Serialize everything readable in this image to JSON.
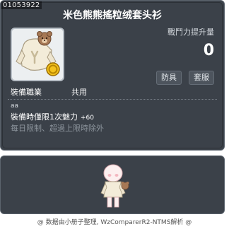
{
  "item": {
    "code": "01053922",
    "name": "米色熊熊搖粒绒套头衫",
    "ability_label": "戰鬥力提升量",
    "power_value": "0",
    "tags": [
      "防具",
      "套服"
    ],
    "job_label": "裝備職業",
    "job_value": "共用",
    "small_text": "aa",
    "effect_text": "裝備時僅限1次魅力",
    "effect_bonus": "+60",
    "limit_text": "每日限制、超過上限時除外"
  },
  "footer": {
    "credit": "@ 数据由小册子整理, WzComparerR2-NTMS解析 @"
  },
  "icons": {
    "item_icon": "bear-fleece-hoodie-icon",
    "coin_icon": "gold-coin-icon",
    "character": "character-preview"
  },
  "colors": {
    "panel_bg": "#3b4149",
    "panel_border": "#5c646e",
    "limit_text": "#8c949c"
  }
}
